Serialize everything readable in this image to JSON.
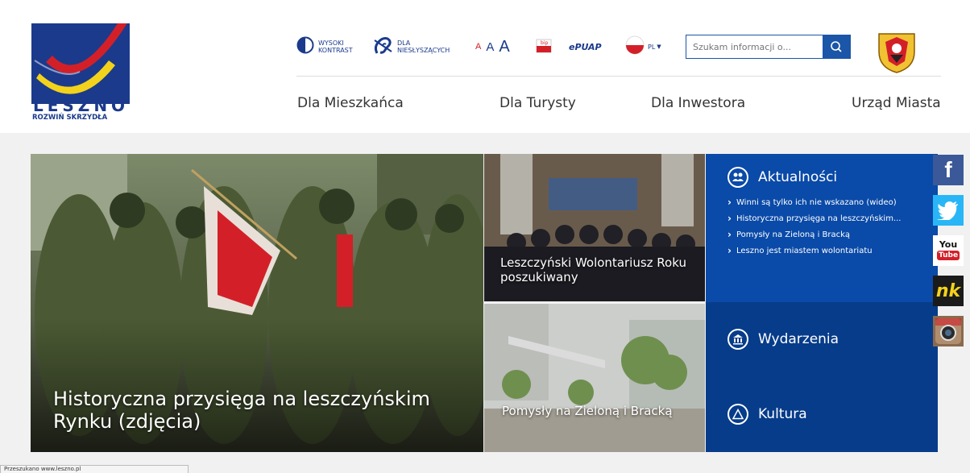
{
  "header": {
    "logo": {
      "title": "LESZNO",
      "subtitle": "ROZWIŃ SKRZYDŁA"
    },
    "tools": {
      "contrast": {
        "line1": "WYSOKI",
        "line2": "KONTRAST"
      },
      "deaf": {
        "line1": "DLA",
        "line2": "NIESŁYSZĄCYCH"
      },
      "font_small": "A",
      "font_medium": "A",
      "font_large": "A",
      "bip": "bip",
      "epuap": "ePUAP",
      "lang": "PL"
    },
    "search": {
      "placeholder": "Szukam informacji o..."
    },
    "nav": [
      "Dla Mieszkańca",
      "Dla Turysty",
      "Dla Inwestora",
      "Urząd Miasta"
    ]
  },
  "tiles": {
    "main": {
      "caption": "Historyczna przysięga na leszczyńskim Rynku (zdjęcia)"
    },
    "top_right": {
      "caption": "Leszczyński Wolontariusz Roku poszukiwany"
    },
    "bottom_right": {
      "caption": "Pomysły na Zieloną i Bracką"
    }
  },
  "panel": {
    "news": {
      "title": "Aktualności",
      "items": [
        "Winni są tylko ich nie wskazano (wideo)",
        "Historyczna przysięga na leszczyńskim...",
        "Pomysły na Zieloną i Bracką",
        "Leszno jest miastem wolontariatu"
      ]
    },
    "events": {
      "title": "Wydarzenia"
    },
    "culture": {
      "title": "Kultura"
    }
  },
  "social": {
    "facebook": "f",
    "youtube_top": "You",
    "youtube_bottom": "Tube",
    "nk": "nk"
  },
  "statusbar": {
    "text": "Przeszukano www.leszno.pl"
  },
  "colors": {
    "brand_blue": "#1b3a8c",
    "panel_blue": "#0a4aa8",
    "panel_dark": "#063c8a",
    "accent_red": "#d32028",
    "accent_yellow": "#f3d21b"
  },
  "icons": {
    "contrast": "contrast-icon",
    "deaf": "ear-icon",
    "bip": "bip-icon",
    "flag": "poland-flag-icon",
    "search": "search-icon",
    "crest": "coat-of-arms-icon",
    "news": "people-icon",
    "events": "building-icon",
    "culture": "warning-icon"
  }
}
